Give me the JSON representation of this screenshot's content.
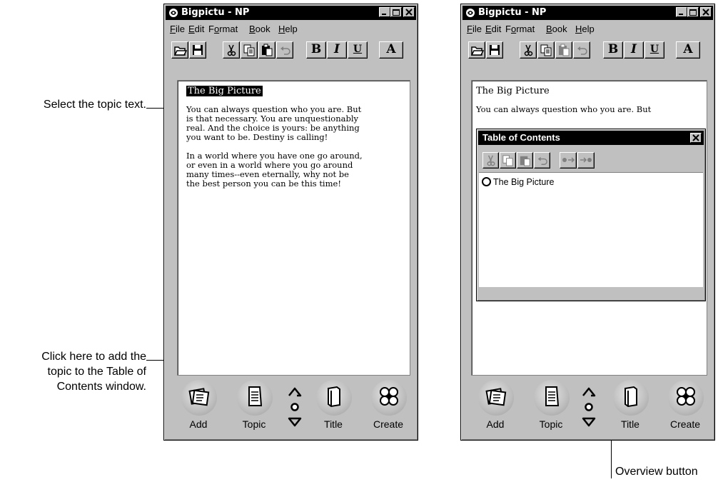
{
  "callouts": {
    "select_text": "Select the topic text.",
    "click_here": [
      "Click here to add the",
      "topic to the Table of",
      "Contents window."
    ],
    "overview": "Overview button"
  },
  "window_title": "Bigpictu - NP",
  "menu": [
    {
      "label": "File",
      "key": "F"
    },
    {
      "label": "Edit",
      "key": "E"
    },
    {
      "label": "Format",
      "key": "o"
    },
    {
      "label": "Book",
      "key": "B"
    },
    {
      "label": "Help",
      "key": "H"
    }
  ],
  "toolbar": {
    "bold": "B",
    "italic": "I",
    "underline": "U",
    "font": "A"
  },
  "document": {
    "title": "The Big Picture",
    "para1": [
      "You can always question who you are.  But",
      "is that necessary. You are unquestionably",
      "real. And the choice is yours: be anything",
      "you want to be.  Destiny is calling!"
    ],
    "para2": [
      "In a world where you have one go around,",
      "or even in a world where you go around",
      "many times--even eternally, why not be",
      "the best person you can be this time!"
    ],
    "para1_first": "You can always question who you are.  But"
  },
  "bottom_buttons": {
    "add": "Add",
    "topic": "Topic",
    "title": "Title",
    "create": "Create"
  },
  "toc": {
    "title": "Table of Contents",
    "item": "The Big Picture"
  }
}
